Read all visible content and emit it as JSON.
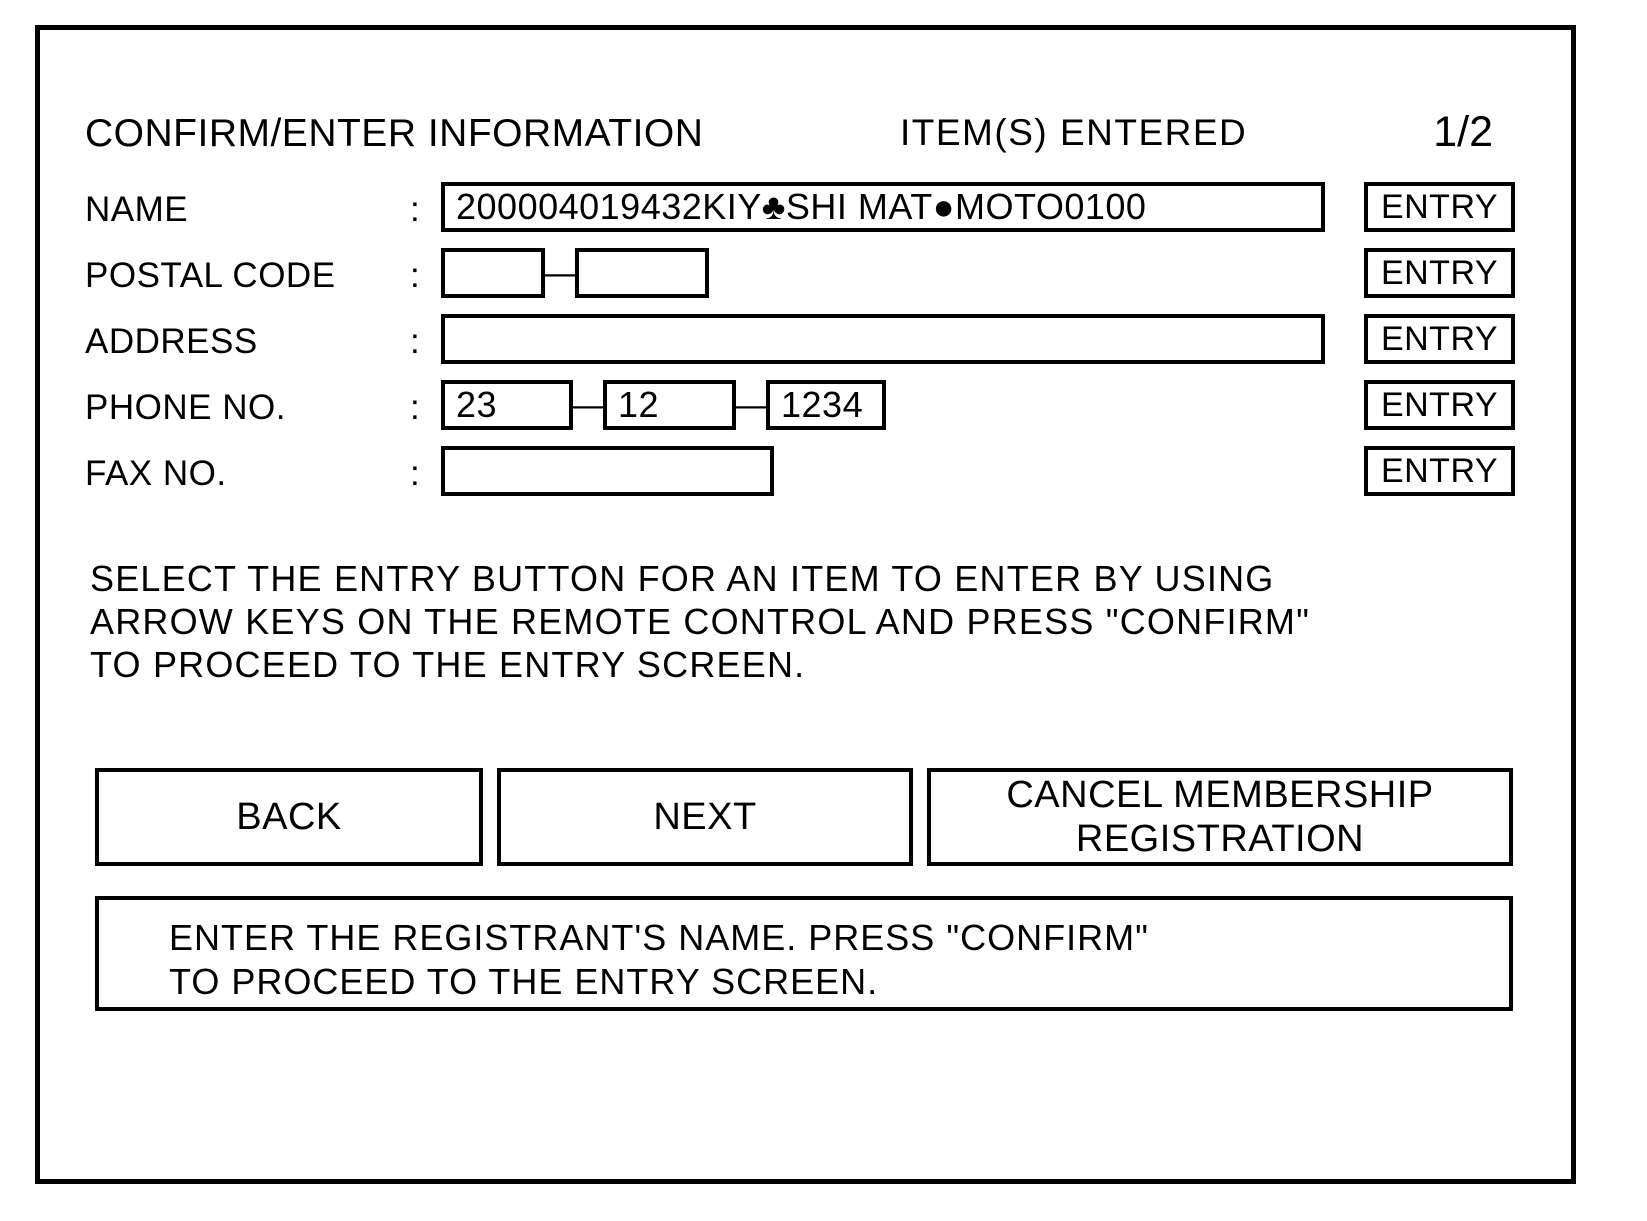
{
  "header": {
    "title": "CONFIRM/ENTER INFORMATION",
    "items_entered_label": "ITEM(S) ENTERED",
    "page_indicator": "1/2"
  },
  "form": {
    "colon": ":",
    "dash": "—",
    "entry_label": "ENTRY",
    "rows": [
      {
        "label": "NAME",
        "fields": [
          {
            "value": "200004019432KIY♣SHI MAT●MOTO0100"
          }
        ]
      },
      {
        "label": "POSTAL CODE",
        "fields": [
          {
            "value": ""
          },
          {
            "value": ""
          }
        ]
      },
      {
        "label": "ADDRESS",
        "fields": [
          {
            "value": ""
          }
        ]
      },
      {
        "label": "PHONE NO.",
        "fields": [
          {
            "value": "23"
          },
          {
            "value": "12"
          },
          {
            "value": "1234"
          }
        ]
      },
      {
        "label": "FAX NO.",
        "fields": [
          {
            "value": ""
          }
        ]
      }
    ]
  },
  "instructions": "SELECT THE ENTRY BUTTON FOR AN ITEM TO ENTER BY USING\nARROW KEYS ON THE REMOTE CONTROL AND PRESS \"CONFIRM\"\nTO PROCEED TO THE ENTRY SCREEN.",
  "actions": {
    "back": "BACK",
    "next": "NEXT",
    "cancel": "CANCEL MEMBERSHIP\nREGISTRATION"
  },
  "status": {
    "message": "ENTER THE REGISTRANT'S NAME. PRESS \"CONFIRM\"\nTO PROCEED TO THE ENTRY SCREEN."
  },
  "colors": {
    "foreground": "#000000",
    "background": "#ffffff"
  }
}
